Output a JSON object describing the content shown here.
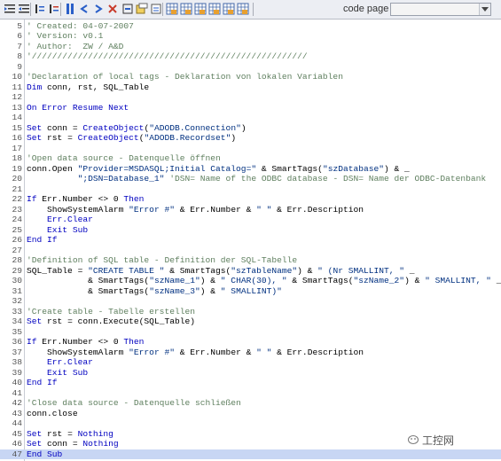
{
  "toolbar": {
    "buttons": [
      "indent-icon",
      "outdent-icon",
      "comment-icon",
      "uncomment-icon",
      "bookmark-icon",
      "prev-bookmark-icon",
      "next-bookmark-icon",
      "clear-bookmarks-icon",
      "goto-icon",
      "find-icon",
      "replace-icon",
      "grid1-icon",
      "grid2-icon",
      "grid3-icon",
      "grid4-icon",
      "grid5-icon",
      "grid6-icon"
    ],
    "code_page_label": "code page",
    "code_page_value": ""
  },
  "lines": [
    {
      "n": "5",
      "segs": [
        [
          "cm",
          "' Created: 04-07-2007"
        ]
      ]
    },
    {
      "n": "6",
      "segs": [
        [
          "cm",
          "' Version: v0.1"
        ]
      ]
    },
    {
      "n": "7",
      "segs": [
        [
          "cm",
          "' Author:  ZW / A&D"
        ]
      ]
    },
    {
      "n": "8",
      "segs": [
        [
          "cm",
          "'//////////////////////////////////////////////////////"
        ]
      ]
    },
    {
      "n": "9",
      "segs": []
    },
    {
      "n": "10",
      "segs": [
        [
          "cm",
          "'Declaration of local tags - Deklaration von lokalen Variablen"
        ]
      ]
    },
    {
      "n": "11",
      "segs": [
        [
          "kw",
          "Dim"
        ],
        [
          "tx",
          " conn, rst, SQL_Table"
        ]
      ]
    },
    {
      "n": "12",
      "segs": []
    },
    {
      "n": "13",
      "segs": [
        [
          "kw",
          "On Error Resume Next"
        ]
      ]
    },
    {
      "n": "14",
      "segs": []
    },
    {
      "n": "15",
      "segs": [
        [
          "kw",
          "Set"
        ],
        [
          "tx",
          " conn = "
        ],
        [
          "kw",
          "CreateObject"
        ],
        [
          "tx",
          "("
        ],
        [
          "str",
          "\"ADODB.Connection\""
        ],
        [
          "tx",
          ")"
        ]
      ]
    },
    {
      "n": "16",
      "segs": [
        [
          "kw",
          "Set"
        ],
        [
          "tx",
          " rst = "
        ],
        [
          "kw",
          "CreateObject"
        ],
        [
          "tx",
          "("
        ],
        [
          "str",
          "\"ADODB.Recordset\""
        ],
        [
          "tx",
          ")"
        ]
      ]
    },
    {
      "n": "17",
      "segs": []
    },
    {
      "n": "18",
      "segs": [
        [
          "cm",
          "'Open data source - Datenquelle öffnen"
        ]
      ]
    },
    {
      "n": "19",
      "segs": [
        [
          "tx",
          "conn.Open "
        ],
        [
          "str",
          "\"Provider=MSDASQL;Initial Catalog=\""
        ],
        [
          "tx",
          " & SmartTags("
        ],
        [
          "str",
          "\"szDatabase\""
        ],
        [
          "tx",
          ") & _"
        ]
      ]
    },
    {
      "n": "20",
      "segs": [
        [
          "tx",
          "          "
        ],
        [
          "str",
          "\";DSN=Database_1\""
        ],
        [
          "cm",
          " 'DSN= Name of the ODBC database - DSN= Name der ODBC-Datenbank"
        ]
      ]
    },
    {
      "n": "21",
      "segs": []
    },
    {
      "n": "22",
      "segs": [
        [
          "kw",
          "If"
        ],
        [
          "tx",
          " Err.Number <> 0 "
        ],
        [
          "kw",
          "Then"
        ]
      ]
    },
    {
      "n": "23",
      "segs": [
        [
          "tx",
          "    ShowSystemAlarm "
        ],
        [
          "str",
          "\"Error #\""
        ],
        [
          "tx",
          " & Err.Number & "
        ],
        [
          "str",
          "\" \""
        ],
        [
          "tx",
          " & Err.Description"
        ]
      ]
    },
    {
      "n": "24",
      "segs": [
        [
          "tx",
          "    "
        ],
        [
          "kw",
          "Err.Clear"
        ]
      ]
    },
    {
      "n": "25",
      "segs": [
        [
          "tx",
          "    "
        ],
        [
          "kw",
          "Exit Sub"
        ]
      ]
    },
    {
      "n": "26",
      "segs": [
        [
          "kw",
          "End If"
        ]
      ]
    },
    {
      "n": "27",
      "segs": []
    },
    {
      "n": "28",
      "segs": [
        [
          "cm",
          "'Definition of SQL table - Definition der SQL-Tabelle"
        ]
      ]
    },
    {
      "n": "29",
      "segs": [
        [
          "tx",
          "SQL_Table = "
        ],
        [
          "str",
          "\"CREATE TABLE \""
        ],
        [
          "tx",
          " & SmartTags("
        ],
        [
          "str",
          "\"szTableName\""
        ],
        [
          "tx",
          ") & "
        ],
        [
          "str",
          "\" (Nr SMALLINT, \""
        ],
        [
          "tx",
          " _"
        ]
      ]
    },
    {
      "n": "30",
      "segs": [
        [
          "tx",
          "            & SmartTags("
        ],
        [
          "str",
          "\"szName_1\""
        ],
        [
          "tx",
          ") & "
        ],
        [
          "str",
          "\" CHAR(30), \""
        ],
        [
          "tx",
          " & SmartTags("
        ],
        [
          "str",
          "\"szName_2\""
        ],
        [
          "tx",
          ") & "
        ],
        [
          "str",
          "\" SMALLINT, \""
        ],
        [
          "tx",
          " _"
        ]
      ]
    },
    {
      "n": "31",
      "segs": [
        [
          "tx",
          "            & SmartTags("
        ],
        [
          "str",
          "\"szName_3\""
        ],
        [
          "tx",
          ") & "
        ],
        [
          "str",
          "\" SMALLINT)\""
        ]
      ]
    },
    {
      "n": "32",
      "segs": []
    },
    {
      "n": "33",
      "segs": [
        [
          "cm",
          "'Create table - Tabelle erstellen"
        ]
      ]
    },
    {
      "n": "34",
      "segs": [
        [
          "kw",
          "Set"
        ],
        [
          "tx",
          " rst = conn.Execute(SQL_Table)"
        ]
      ]
    },
    {
      "n": "35",
      "segs": []
    },
    {
      "n": "36",
      "segs": [
        [
          "kw",
          "If"
        ],
        [
          "tx",
          " Err.Number <> 0 "
        ],
        [
          "kw",
          "Then"
        ]
      ]
    },
    {
      "n": "37",
      "segs": [
        [
          "tx",
          "    ShowSystemAlarm "
        ],
        [
          "str",
          "\"Error #\""
        ],
        [
          "tx",
          " & Err.Number & "
        ],
        [
          "str",
          "\" \""
        ],
        [
          "tx",
          " & Err.Description"
        ]
      ]
    },
    {
      "n": "38",
      "segs": [
        [
          "tx",
          "    "
        ],
        [
          "kw",
          "Err.Clear"
        ]
      ]
    },
    {
      "n": "39",
      "segs": [
        [
          "tx",
          "    "
        ],
        [
          "kw",
          "Exit Sub"
        ]
      ]
    },
    {
      "n": "40",
      "segs": [
        [
          "kw",
          "End If"
        ]
      ]
    },
    {
      "n": "41",
      "segs": []
    },
    {
      "n": "42",
      "segs": [
        [
          "cm",
          "'Close data source - Datenquelle schließen"
        ]
      ]
    },
    {
      "n": "43",
      "segs": [
        [
          "tx",
          "conn.close"
        ]
      ]
    },
    {
      "n": "44",
      "segs": []
    },
    {
      "n": "45",
      "segs": [
        [
          "kw",
          "Set"
        ],
        [
          "tx",
          " rst = "
        ],
        [
          "kw",
          "Nothing"
        ]
      ]
    },
    {
      "n": "46",
      "segs": [
        [
          "kw",
          "Set"
        ],
        [
          "tx",
          " conn = "
        ],
        [
          "kw",
          "Nothing"
        ]
      ]
    },
    {
      "n": "47",
      "segs": [
        [
          "kw",
          "End Sub"
        ]
      ],
      "highlight": true
    }
  ],
  "watermark": "工控网",
  "colors": {
    "keyword": "#0000c0",
    "comment": "#608060",
    "string": "#003080",
    "highlight": "#c8d6f4"
  }
}
